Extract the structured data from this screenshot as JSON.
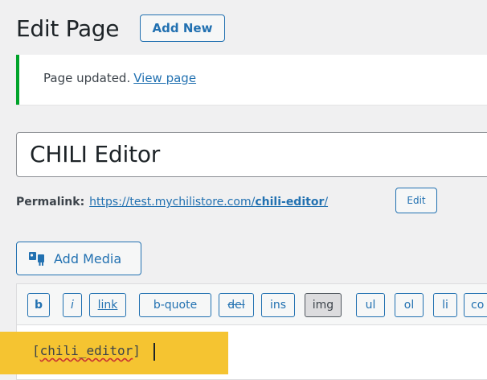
{
  "header": {
    "title": "Edit Page",
    "add_new_label": "Add New"
  },
  "notice": {
    "message": "Page updated.",
    "link_label": "View page",
    "status_color": "#00a32a"
  },
  "post": {
    "title_value": "CHILI Editor"
  },
  "permalink": {
    "label": "Permalink:",
    "url_prefix": "https://test.mychilistore.com/",
    "url_slug": "chili-editor",
    "url_suffix": "/",
    "edit_label": "Edit"
  },
  "media": {
    "add_media_label": "Add Media",
    "icon": "media-icon"
  },
  "quicktags": {
    "buttons": [
      "b",
      "i",
      "link",
      "b-quote",
      "del",
      "ins",
      "img",
      "ul",
      "ol",
      "li",
      "co"
    ],
    "active": "img"
  },
  "editor": {
    "content_open": "[",
    "content_word": "chili_editor",
    "content_close": "]",
    "highlight_color": "#f5c431"
  },
  "colors": {
    "accent": "#2271b1",
    "background": "#f0f0f1"
  }
}
